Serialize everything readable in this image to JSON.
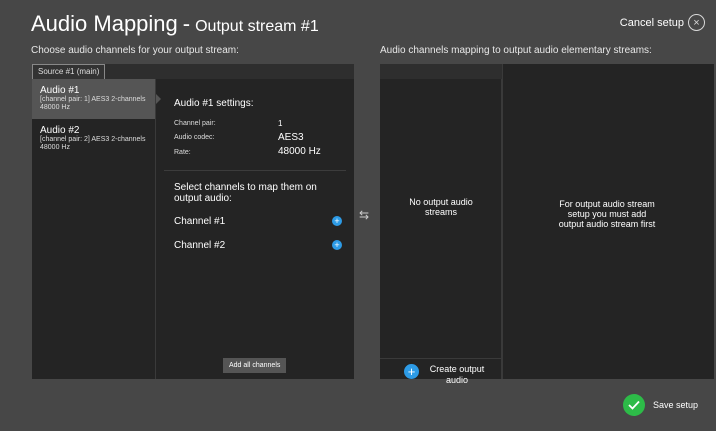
{
  "header": {
    "title": "Audio Mapping",
    "title_sep": "-",
    "subtitle": "Output stream #1",
    "cancel_label": "Cancel setup",
    "cancel_icon": "close-icon"
  },
  "left": {
    "heading": "Choose audio channels for your output stream:",
    "tab_label": "Source #1 (main)",
    "sources": [
      {
        "name": "Audio #1",
        "desc": "[channel pair: 1] AES3 2-channels 48000 Hz"
      },
      {
        "name": "Audio #2",
        "desc": "[channel pair: 2] AES3 2-channels 48000 Hz"
      }
    ],
    "settings": {
      "title": "Audio #1 settings:",
      "rows": [
        {
          "key": "Channel pair:",
          "value": "1"
        },
        {
          "key": "Audio codec:",
          "value": "AES3"
        },
        {
          "key": "Rate:",
          "value": "48000 Hz"
        }
      ],
      "select_text": "Select channels to map them on output audio:",
      "channels": [
        "Channel #1",
        "Channel #2"
      ],
      "add_all_label": "Add all channels"
    }
  },
  "swap_icon": "swap-arrows-icon",
  "right": {
    "heading": "Audio channels mapping to output audio elementary streams:",
    "no_streams": "No output audio streams",
    "create_label": "Create output audio",
    "hint": "For output audio stream setup you must add output audio stream first"
  },
  "footer": {
    "save_label": "Save setup",
    "accent_green": "#2dbb48",
    "accent_blue": "#2d9be6"
  }
}
